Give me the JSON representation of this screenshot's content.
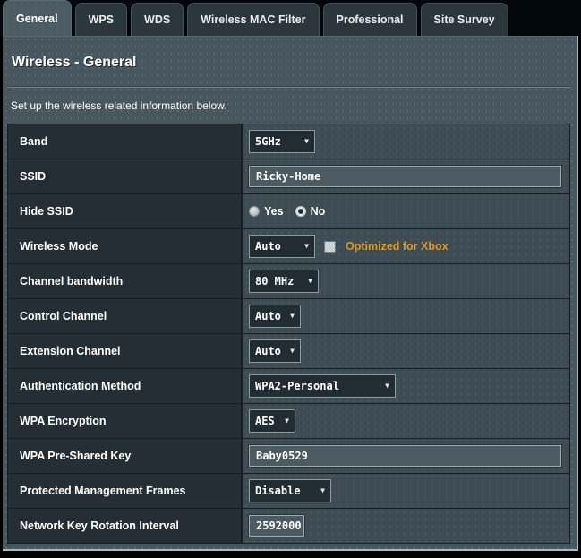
{
  "tabs": [
    {
      "label": "General",
      "active": true
    },
    {
      "label": "WPS",
      "active": false
    },
    {
      "label": "WDS",
      "active": false
    },
    {
      "label": "Wireless MAC Filter",
      "active": false
    },
    {
      "label": "Professional",
      "active": false
    },
    {
      "label": "Site Survey",
      "active": false
    }
  ],
  "page": {
    "title": "Wireless - General",
    "description": "Set up the wireless related information below."
  },
  "colors": {
    "accent_orange": "#d8992e",
    "label_cell_bg": "#242e34",
    "value_cell_bg": "#3e4c53",
    "content_bg": "#48565d"
  },
  "form": {
    "rows": [
      {
        "label": "Band",
        "control": "select",
        "value": "5GHz"
      },
      {
        "label": "SSID",
        "control": "text",
        "value": "Ricky-Home"
      },
      {
        "label": "Hide SSID",
        "control": "radio",
        "options": [
          {
            "label": "Yes",
            "selected": false
          },
          {
            "label": "No",
            "selected": true
          }
        ]
      },
      {
        "label": "Wireless Mode",
        "control": "select+checkbox",
        "value": "Auto",
        "checkbox_label": "Optimized for Xbox",
        "checked": false
      },
      {
        "label": "Channel bandwidth",
        "control": "select",
        "value": "80 MHz"
      },
      {
        "label": "Control Channel",
        "control": "select",
        "value": "Auto"
      },
      {
        "label": "Extension Channel",
        "control": "select",
        "value": "Auto"
      },
      {
        "label": "Authentication Method",
        "control": "select",
        "value": "WPA2-Personal"
      },
      {
        "label": "WPA Encryption",
        "control": "select",
        "value": "AES"
      },
      {
        "label": "WPA Pre-Shared Key",
        "control": "text",
        "value": "Baby0529"
      },
      {
        "label": "Protected Management Frames",
        "control": "select",
        "value": "Disable"
      },
      {
        "label": "Network Key Rotation Interval",
        "control": "text",
        "value": "2592000"
      }
    ]
  }
}
